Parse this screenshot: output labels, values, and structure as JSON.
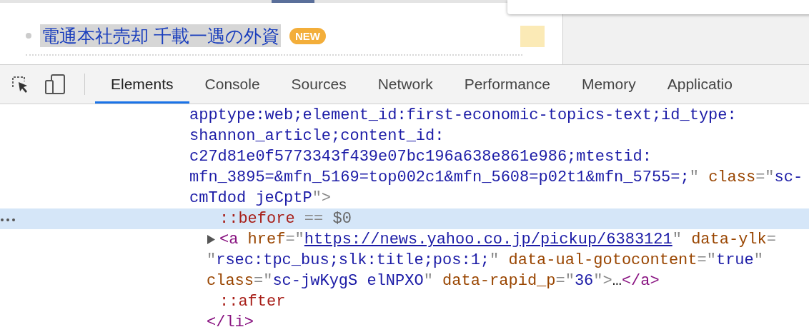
{
  "page": {
    "headline": "電通本社売却 千載一遇の外資",
    "badge": "NEW",
    "headline_selected": true
  },
  "toolbar": {
    "tabs": [
      {
        "label": "Elements",
        "selected": true
      },
      {
        "label": "Console",
        "selected": false
      },
      {
        "label": "Sources",
        "selected": false
      },
      {
        "label": "Network",
        "selected": false
      },
      {
        "label": "Performance",
        "selected": false
      },
      {
        "label": "Memory",
        "selected": false
      },
      {
        "label": "Applicatio",
        "selected": false
      }
    ]
  },
  "code_lines": [
    {
      "kind": "wrap",
      "selected": false,
      "segments": [
        {
          "kind": "value",
          "text": "apptype:web;element_id:first-economic-topics-text;id_type:"
        }
      ]
    },
    {
      "kind": "wrap",
      "selected": false,
      "segments": [
        {
          "kind": "value",
          "text": "shannon_article;content_id:"
        }
      ]
    },
    {
      "kind": "wrap",
      "selected": false,
      "segments": [
        {
          "kind": "value",
          "text": "c27d81e0f5773343f439e07bc196a638e861e986;mtestid:"
        }
      ]
    },
    {
      "kind": "wrap",
      "selected": false,
      "segments": [
        {
          "kind": "value",
          "text": "mfn_3895=&mfn_5169=top002c1&mfn_5608=p02t1&mfn_5755=;"
        },
        {
          "kind": "punct",
          "text": "\" "
        },
        {
          "kind": "attr",
          "text": "class"
        },
        {
          "kind": "punct",
          "text": "=\""
        },
        {
          "kind": "value",
          "text": "sc-"
        }
      ]
    },
    {
      "kind": "wrap",
      "selected": false,
      "segments": [
        {
          "kind": "value",
          "text": "cmTdod jeCptP"
        },
        {
          "kind": "punct",
          "text": "\">"
        }
      ]
    },
    {
      "kind": "child",
      "selected": true,
      "segments": [
        {
          "kind": "pseudo",
          "text": "::before"
        },
        {
          "kind": "punct",
          "text": " == "
        },
        {
          "kind": "var",
          "text": "$0"
        }
      ]
    },
    {
      "kind": "node",
      "selected": false,
      "segments": [
        {
          "kind": "tag",
          "text": "<a"
        },
        {
          "kind": "attr",
          "text": " href"
        },
        {
          "kind": "punct",
          "text": "=\""
        },
        {
          "kind": "link",
          "text": "https://news.yahoo.co.jp/pickup/6383121"
        },
        {
          "kind": "punct",
          "text": "\" "
        },
        {
          "kind": "attr",
          "text": "data-ylk"
        },
        {
          "kind": "punct",
          "text": "="
        }
      ]
    },
    {
      "kind": "child-wrap",
      "selected": false,
      "segments": [
        {
          "kind": "punct",
          "text": "\""
        },
        {
          "kind": "value",
          "text": "rsec:tpc_bus;slk:title;pos:1;"
        },
        {
          "kind": "punct",
          "text": "\" "
        },
        {
          "kind": "attr",
          "text": "data-ual-gotocontent"
        },
        {
          "kind": "punct",
          "text": "=\""
        },
        {
          "kind": "value",
          "text": "true"
        },
        {
          "kind": "punct",
          "text": "\""
        }
      ]
    },
    {
      "kind": "child-wrap",
      "selected": false,
      "segments": [
        {
          "kind": "attr",
          "text": "class"
        },
        {
          "kind": "punct",
          "text": "=\""
        },
        {
          "kind": "value",
          "text": "sc-jwKygS elNPXO"
        },
        {
          "kind": "punct",
          "text": "\" "
        },
        {
          "kind": "attr",
          "text": "data-rapid_p"
        },
        {
          "kind": "punct",
          "text": "=\""
        },
        {
          "kind": "value",
          "text": "36"
        },
        {
          "kind": "punct",
          "text": "\">"
        },
        {
          "kind": "plain",
          "text": "…"
        },
        {
          "kind": "tag",
          "text": "</a>"
        }
      ]
    },
    {
      "kind": "child",
      "selected": false,
      "segments": [
        {
          "kind": "pseudo",
          "text": "::after"
        }
      ]
    },
    {
      "kind": "child-wrap",
      "selected": false,
      "segments": [
        {
          "kind": "tag",
          "text": "</li>"
        }
      ]
    }
  ]
}
